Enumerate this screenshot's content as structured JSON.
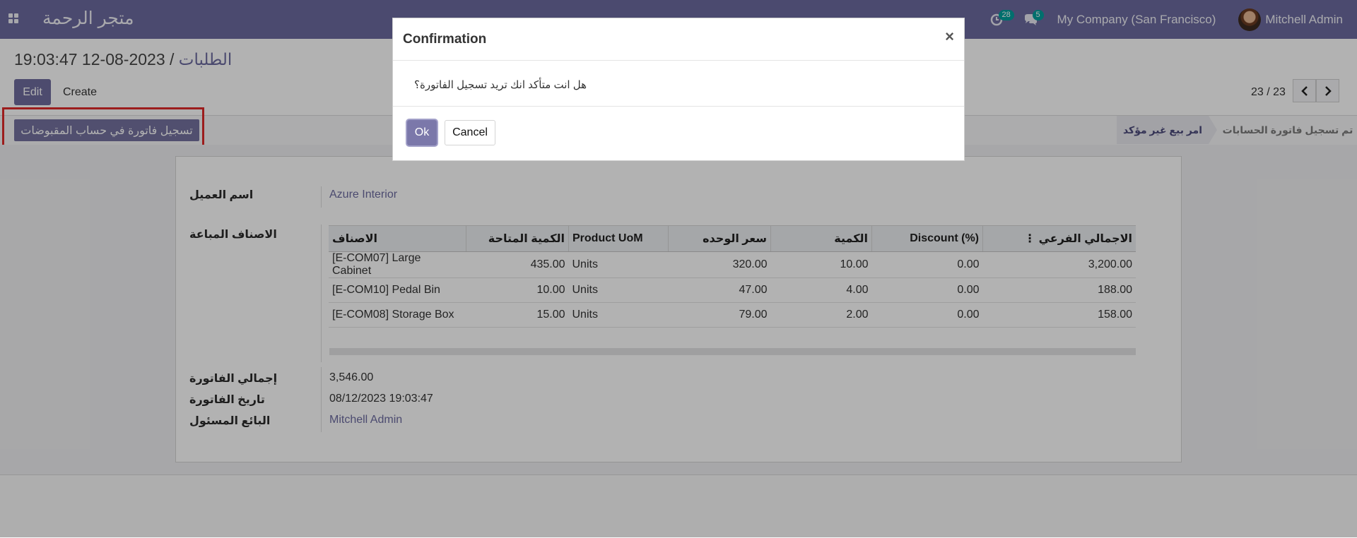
{
  "topbar": {
    "app_name": "متجر الرحمة",
    "activity_count": "28",
    "message_count": "5",
    "company": "My Company (San Francisco)",
    "user": "Mitchell Admin",
    "color": "#6c6ba0"
  },
  "breadcrumb": {
    "parent": "الطلبات",
    "separator": "/",
    "current": "2023-08-12 19:03:47"
  },
  "buttons": {
    "edit": "Edit",
    "create": "Create",
    "post_invoice": "تسجيل فاتورة في حساب المقبوضات"
  },
  "pager": {
    "text": "23 / 23"
  },
  "statusbar": {
    "active_stage": "امر بيع غير مؤكد",
    "done_stage": "تم تسجيل فاتورة الحسابات"
  },
  "form": {
    "customer_label": "اسم العميل",
    "customer_value": "Azure Interior",
    "lines_label": "الاصناف المباعة",
    "total_label": "إجمالي الفاتورة",
    "total_value": "3,546.00",
    "date_label": "تاريخ الفاتورة",
    "date_value": "08/12/2023 19:03:47",
    "salesperson_label": "البائع المسئول",
    "salesperson_value": "Mitchell Admin"
  },
  "lines_table": {
    "headers": [
      "الاصناف",
      "الكمية المتاحة",
      "Product UoM",
      "سعر الوحده",
      "الكمية",
      "Discount (%)",
      "الاجمالي الفرعي"
    ],
    "rows": [
      [
        "[E-COM07] Large Cabinet",
        "435.00",
        "Units",
        "320.00",
        "10.00",
        "0.00",
        "3,200.00"
      ],
      [
        "[E-COM10] Pedal Bin",
        "10.00",
        "Units",
        "47.00",
        "4.00",
        "0.00",
        "188.00"
      ],
      [
        "[E-COM08] Storage Box",
        "15.00",
        "Units",
        "79.00",
        "2.00",
        "0.00",
        "158.00"
      ]
    ]
  },
  "dialog": {
    "title": "Confirmation",
    "close_symbol": "×",
    "message": "هل انت متأكد انك تريد تسجيل الفاتورة؟",
    "ok": "Ok",
    "cancel": "Cancel"
  }
}
